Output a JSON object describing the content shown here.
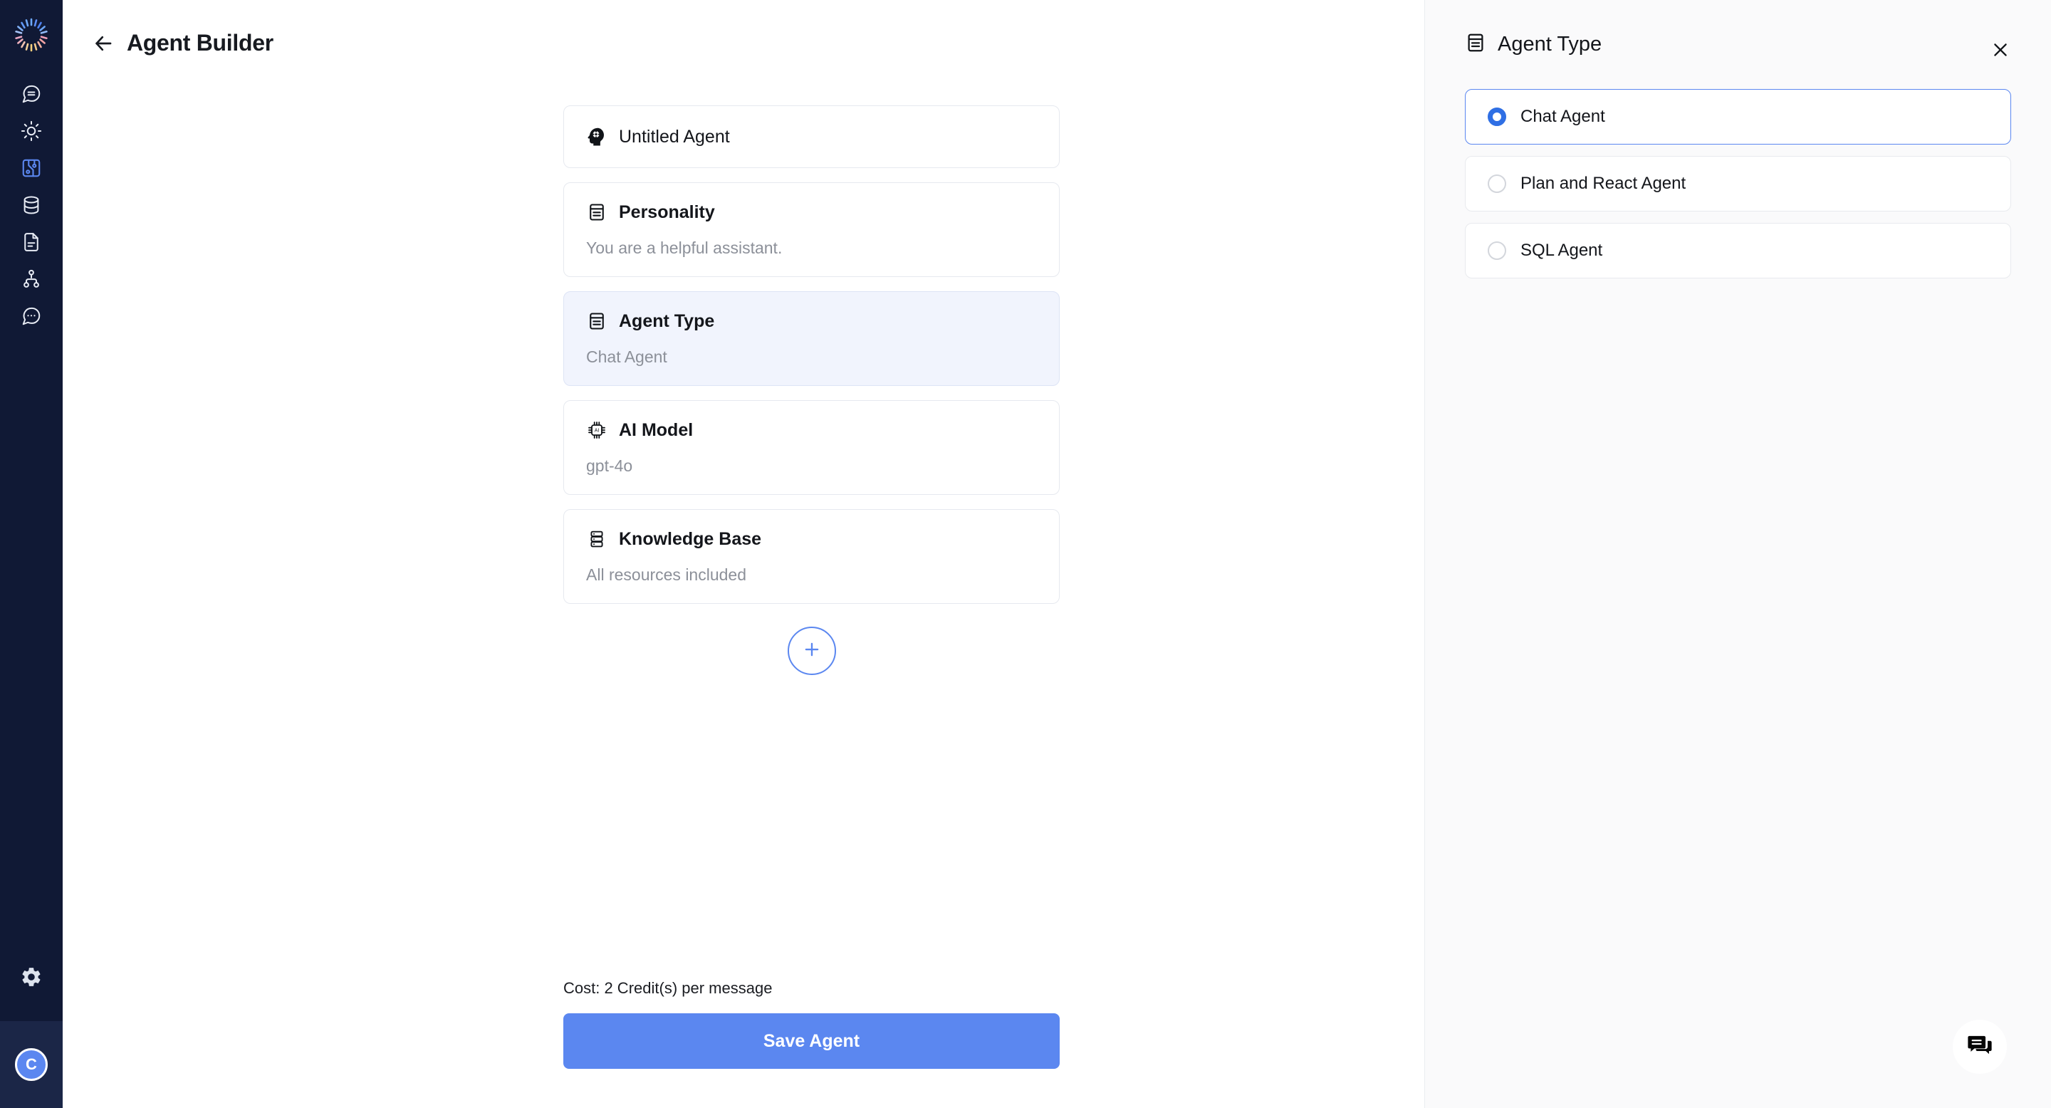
{
  "sidebar": {
    "logo_name": "radial-burst-logo",
    "items": [
      {
        "icon": "chat-equals-icon",
        "name": "chat",
        "active": false
      },
      {
        "icon": "sun-gear-icon",
        "name": "settings-sun",
        "active": false
      },
      {
        "icon": "circuit-flow-icon",
        "name": "agent-builder",
        "active": true
      },
      {
        "icon": "database-icon",
        "name": "database",
        "active": false
      },
      {
        "icon": "document-icon",
        "name": "documents",
        "active": false
      },
      {
        "icon": "org-chart-icon",
        "name": "workflows",
        "active": false
      },
      {
        "icon": "chat-dots-icon",
        "name": "conversations",
        "active": false
      }
    ],
    "settings_icon": "gear-icon",
    "avatar_initial": "C"
  },
  "header": {
    "back_icon": "back-arrow-icon",
    "title": "Agent Builder"
  },
  "builder": {
    "cards": [
      {
        "icon": "head-gear-icon",
        "title": "Untitled Agent",
        "subtitle": null,
        "selected": false,
        "title_weight": "medium"
      },
      {
        "icon": "article-icon",
        "title": "Personality",
        "subtitle": "You are a helpful assistant.",
        "selected": false,
        "title_weight": "bold"
      },
      {
        "icon": "article-icon",
        "title": "Agent Type",
        "subtitle": "Chat Agent",
        "selected": true,
        "title_weight": "bold"
      },
      {
        "icon": "cpu-ai-icon",
        "title": "AI Model",
        "subtitle": "gpt-4o",
        "selected": false,
        "title_weight": "bold"
      },
      {
        "icon": "database-stack-icon",
        "title": "Knowledge Base",
        "subtitle": "All resources included",
        "selected": false,
        "title_weight": "bold"
      }
    ],
    "add_button_icon": "plus-icon",
    "cost_text": "Cost: 2 Credit(s) per message",
    "save_label": "Save Agent"
  },
  "panel": {
    "icon": "article-icon",
    "title": "Agent Type",
    "close_icon": "close-icon",
    "options": [
      {
        "label": "Chat Agent",
        "selected": true
      },
      {
        "label": "Plan and React Agent",
        "selected": false
      },
      {
        "label": "SQL Agent",
        "selected": false
      }
    ]
  },
  "chat_widget": {
    "icon": "chat-bubbles-icon"
  },
  "colors": {
    "accent_blue": "#5B87F0",
    "radio_blue": "#2f6fe4",
    "sidebar_bg": "#101935",
    "selected_card_bg": "#f1f4fd",
    "panel_bg": "#fafafb"
  }
}
